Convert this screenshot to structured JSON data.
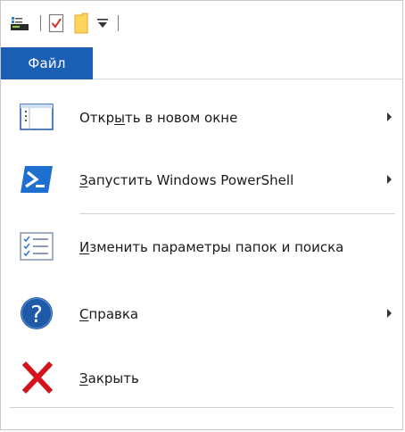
{
  "ribbon": {
    "file_tab_label": "Файл"
  },
  "menu": {
    "items": [
      {
        "pre": "Откр",
        "u": "ы",
        "post": "ть в новом окне",
        "has_submenu": true,
        "icon": "new-window-icon"
      },
      {
        "pre": "",
        "u": "З",
        "post": "апустить Windows PowerShell",
        "has_submenu": true,
        "icon": "powershell-icon"
      },
      {
        "pre": "",
        "u": "И",
        "post": "зменить параметры папок и поиска",
        "has_submenu": false,
        "icon": "folder-options-icon"
      },
      {
        "pre": "",
        "u": "С",
        "post": "правка",
        "has_submenu": true,
        "icon": "help-icon"
      },
      {
        "pre": "",
        "u": "З",
        "post": "акрыть",
        "has_submenu": false,
        "icon": "close-icon"
      }
    ]
  },
  "colors": {
    "file_tab_bg": "#1a5fb4",
    "powershell_blue": "#1f6fd1",
    "help_blue": "#1e5aa8",
    "close_red": "#d4141c"
  }
}
